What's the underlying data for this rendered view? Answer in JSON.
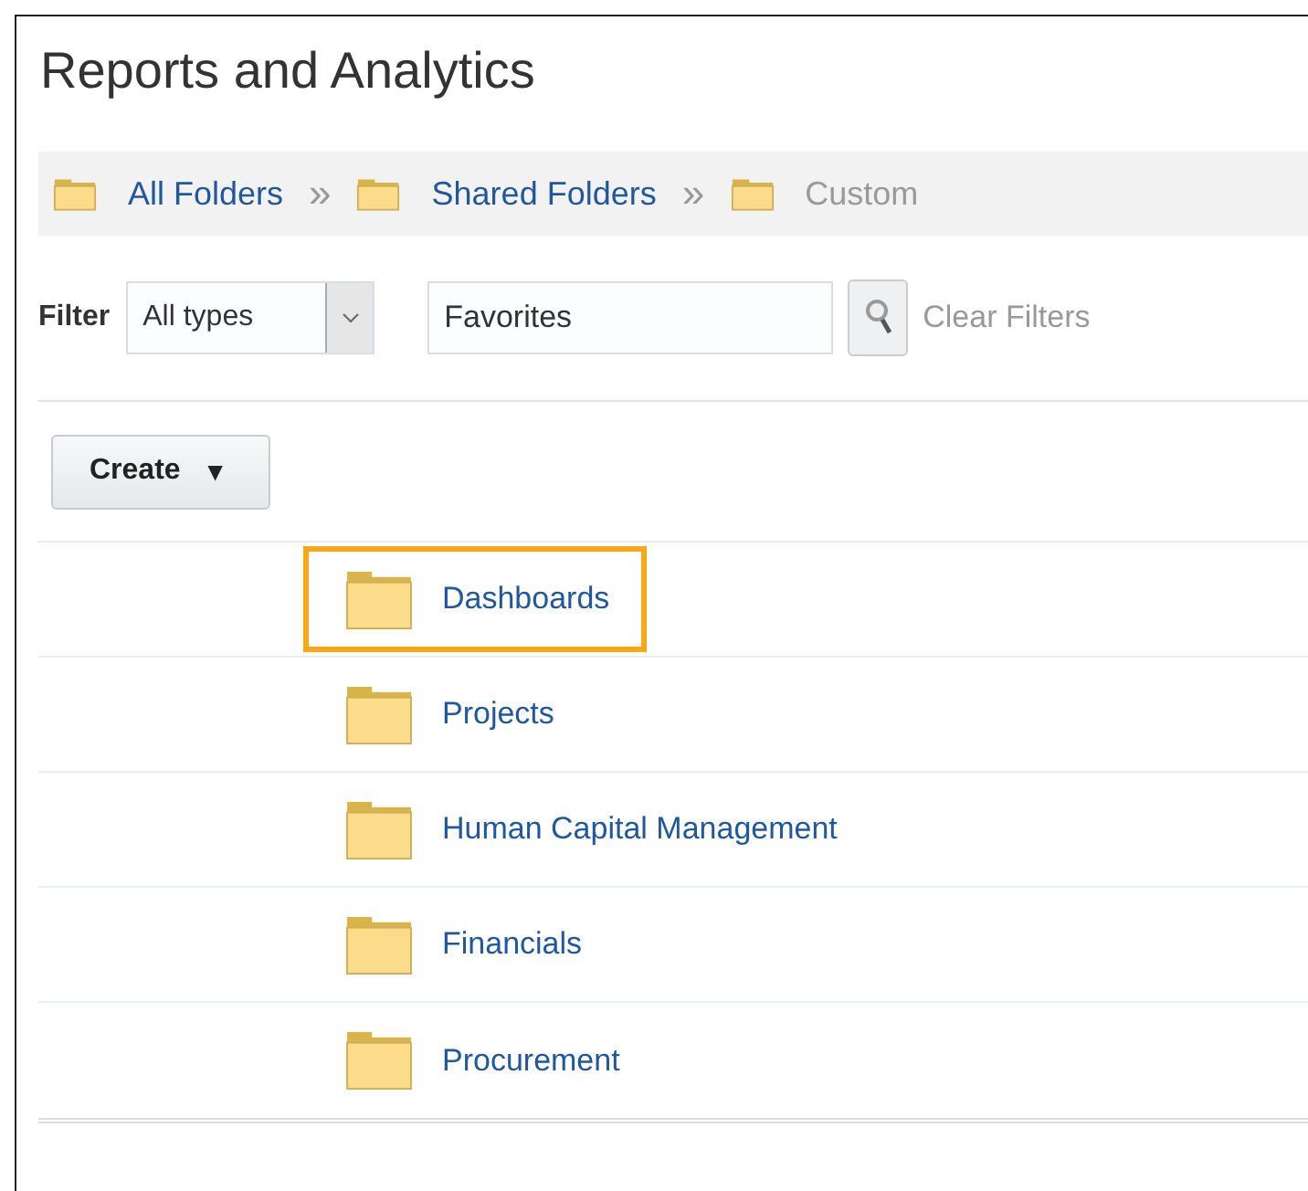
{
  "title": "Reports and Analytics",
  "breadcrumb": [
    {
      "label": "All Folders",
      "current": false
    },
    {
      "label": "Shared Folders",
      "current": false
    },
    {
      "label": "Custom",
      "current": true
    }
  ],
  "breadcrumb_separator": "»",
  "filter": {
    "label": "Filter",
    "type_value": "All types",
    "search_value": "Favorites",
    "clear_label": "Clear Filters"
  },
  "create_button": {
    "label": "Create",
    "caret": "▼"
  },
  "folders": [
    {
      "name": "Dashboards",
      "highlighted": true
    },
    {
      "name": "Projects",
      "highlighted": false
    },
    {
      "name": "Human Capital Management",
      "highlighted": false
    },
    {
      "name": "Financials",
      "highlighted": false
    },
    {
      "name": "Procurement",
      "highlighted": false
    }
  ]
}
